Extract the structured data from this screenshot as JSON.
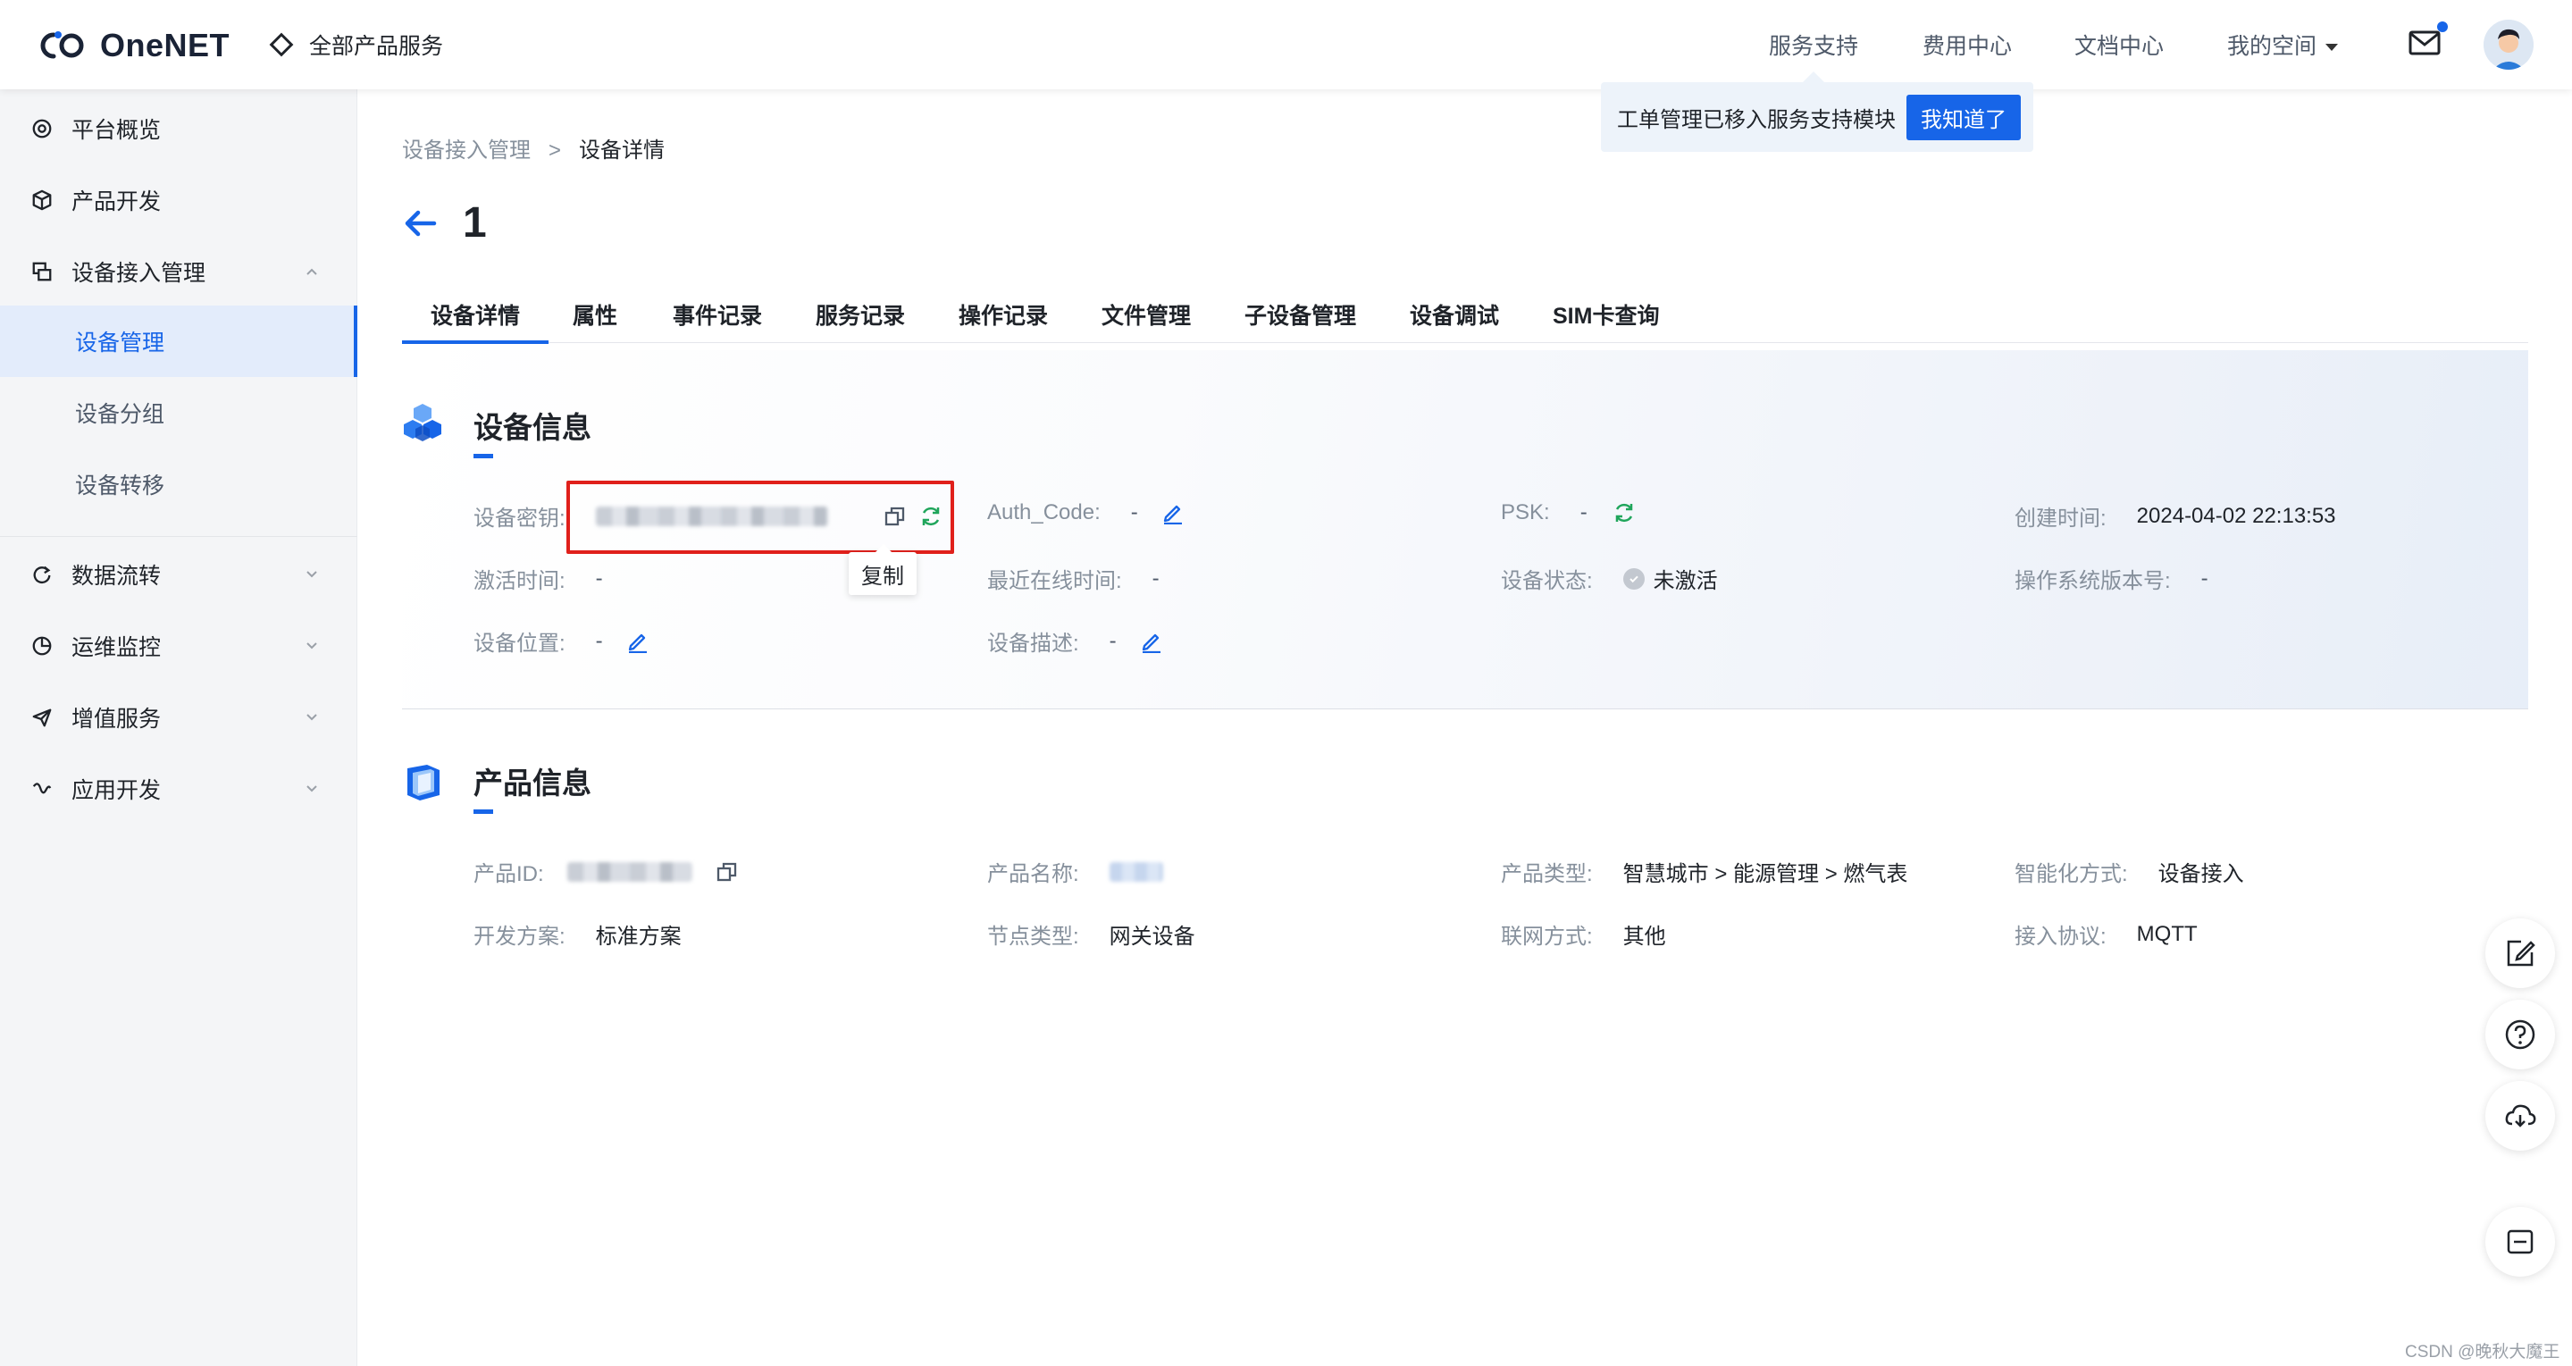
{
  "brand": {
    "name": "OneNET"
  },
  "topbar": {
    "all_products": "全部产品服务",
    "nav": [
      "服务支持",
      "费用中心",
      "文档中心",
      "我的空间"
    ],
    "notice_text": "工单管理已移入服务支持模块",
    "notice_button": "我知道了"
  },
  "sidebar": {
    "items": [
      {
        "label": "平台概览",
        "icon": "gauge-icon"
      },
      {
        "label": "产品开发",
        "icon": "cube-icon"
      },
      {
        "label": "设备接入管理",
        "icon": "device-icon",
        "expanded": true
      },
      {
        "label": "数据流转",
        "icon": "flow-icon"
      },
      {
        "label": "运维监控",
        "icon": "pie-icon"
      },
      {
        "label": "增值服务",
        "icon": "send-icon"
      },
      {
        "label": "应用开发",
        "icon": "app-icon"
      }
    ],
    "sub_items": [
      "设备管理",
      "设备分组",
      "设备转移"
    ],
    "active_sub": "设备管理"
  },
  "breadcrumb": {
    "parent": "设备接入管理",
    "separator": ">",
    "current": "设备详情"
  },
  "page": {
    "title": "1"
  },
  "tabs": [
    "设备详情",
    "属性",
    "事件记录",
    "服务记录",
    "操作记录",
    "文件管理",
    "子设备管理",
    "设备调试",
    "SIM卡查询"
  ],
  "device_info": {
    "title": "设备信息",
    "fields": {
      "secret_label": "设备密钥:",
      "auth_label": "Auth_Code:",
      "auth_value": "-",
      "psk_label": "PSK:",
      "psk_value": "-",
      "created_label": "创建时间:",
      "created_value": "2024-04-02 22:13:53",
      "activated_label": "激活时间:",
      "activated_value": "-",
      "last_online_label": "最近在线时间:",
      "last_online_value": "-",
      "status_label": "设备状态:",
      "status_value": "未激活",
      "os_label": "操作系统版本号:",
      "os_value": "-",
      "location_label": "设备位置:",
      "location_value": "-",
      "desc_label": "设备描述:",
      "desc_value": "-"
    },
    "copy_tooltip": "复制"
  },
  "product_info": {
    "title": "产品信息",
    "fields": {
      "id_label": "产品ID:",
      "name_label": "产品名称:",
      "type_label": "产品类型:",
      "type_value": "智慧城市 > 能源管理 > 燃气表",
      "smart_label": "智能化方式:",
      "smart_value": "设备接入",
      "plan_label": "开发方案:",
      "plan_value": "标准方案",
      "node_label": "节点类型:",
      "node_value": "网关设备",
      "network_label": "联网方式:",
      "network_value": "其他",
      "protocol_label": "接入协议:",
      "protocol_value": "MQTT"
    }
  },
  "floating_buttons": [
    "edit-icon",
    "help-icon",
    "cloud-icon",
    "collapse-icon"
  ],
  "watermark": "CSDN @晚秋大魔王",
  "colors": {
    "accent": "#1765e8",
    "highlight_box": "#e0201b",
    "status_green": "#1fa55b"
  }
}
